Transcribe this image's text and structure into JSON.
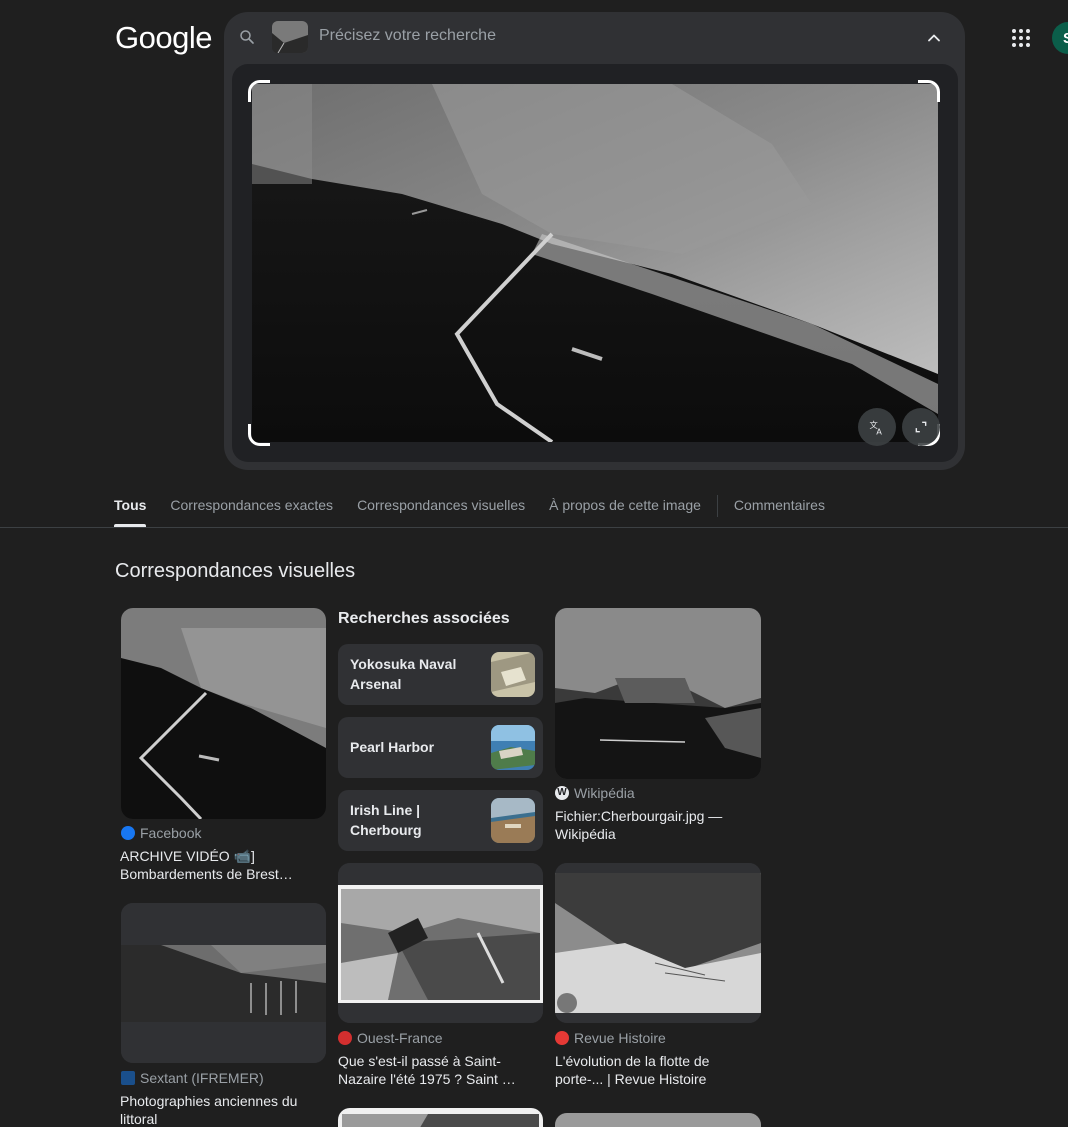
{
  "header": {
    "logo": "Google",
    "search_placeholder": "Précisez votre recherche",
    "avatar_letter": "S"
  },
  "tabs": [
    {
      "label": "Tous",
      "active": true
    },
    {
      "label": "Correspondances exactes",
      "active": false
    },
    {
      "label": "Correspondances visuelles",
      "active": false
    },
    {
      "label": "À propos de cette image",
      "active": false
    },
    {
      "label": "Commentaires",
      "active": false
    }
  ],
  "section_title": "Correspondances visuelles",
  "related": {
    "heading": "Recherches associées",
    "items": [
      {
        "label": "Yokosuka Naval Arsenal"
      },
      {
        "label": "Pearl Harbor"
      },
      {
        "label": "Irish Line | Cherbourg"
      }
    ]
  },
  "results": [
    {
      "source": "Facebook",
      "title": "ARCHIVE VIDÉO 📹] Bombardements de Brest…",
      "source_color": "#1877f2"
    },
    {
      "source": "Wikipédia",
      "title": "Fichier:Cherbourgair.jpg — Wikipédia",
      "source_color": "#e8eaed"
    },
    {
      "source": "Sextant (IFREMER)",
      "title": "Photographies anciennes du littoral",
      "source_color": "#1a4f8b"
    },
    {
      "source": "Ouest-France",
      "title": "Que s'est-il passé à Saint-Nazaire l'été 1975 ? Saint …",
      "source_color": "#d32f2f"
    },
    {
      "source": "Revue Histoire",
      "title": "L'évolution de la flotte de porte-... | Revue Histoire",
      "source_color": "#e53935"
    }
  ],
  "colors": {
    "background": "#1f1f1f",
    "panel": "#303134",
    "text_primary": "#e8eaed",
    "text_secondary": "#9aa0a6"
  }
}
